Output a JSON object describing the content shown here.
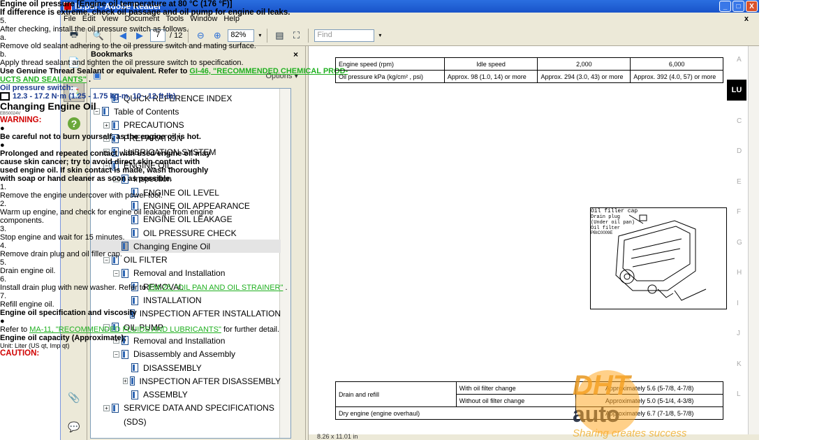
{
  "window": {
    "title": "lu.pdf - Adobe Reader",
    "minimize": "_",
    "maximize": "□",
    "close": "X"
  },
  "menu": [
    "File",
    "Edit",
    "View",
    "Document",
    "Tools",
    "Window",
    "Help"
  ],
  "menu_close": "x",
  "toolbar": {
    "page_current": "7",
    "page_total": "/ 12",
    "zoom": "82%",
    "find_placeholder": "Find"
  },
  "bookmarks": {
    "title": "Bookmarks",
    "close": "×",
    "options": "Options ▾",
    "items": [
      {
        "label": "QUICK REFERENCE INDEX",
        "level": 1,
        "exp": ""
      },
      {
        "label": "Table of Contents",
        "level": 0,
        "exp": "−"
      },
      {
        "label": "PRECAUTIONS",
        "level": 1,
        "exp": "+"
      },
      {
        "label": "PREPARATION",
        "level": 1,
        "exp": "+"
      },
      {
        "label": "LUBRICATION SYSTEM",
        "level": 1,
        "exp": "+"
      },
      {
        "label": "ENGINE OIL",
        "level": 1,
        "exp": "−"
      },
      {
        "label": "Inspection",
        "level": 2,
        "exp": "−"
      },
      {
        "label": "ENGINE OIL LEVEL",
        "level": 3,
        "exp": ""
      },
      {
        "label": "ENGINE OIL APPEARANCE",
        "level": 3,
        "exp": ""
      },
      {
        "label": "ENGINE OIL LEAKAGE",
        "level": 3,
        "exp": ""
      },
      {
        "label": "OIL PRESSURE CHECK",
        "level": 3,
        "exp": ""
      },
      {
        "label": "Changing Engine Oil",
        "level": 2,
        "exp": "",
        "selected": true
      },
      {
        "label": "OIL FILTER",
        "level": 1,
        "exp": "−"
      },
      {
        "label": "Removal and Installation",
        "level": 2,
        "exp": "−"
      },
      {
        "label": "REMOVAL",
        "level": 3,
        "exp": ""
      },
      {
        "label": "INSTALLATION",
        "level": 3,
        "exp": ""
      },
      {
        "label": "INSPECTION AFTER INSTALLATION",
        "level": 3,
        "exp": ""
      },
      {
        "label": "OIL PUMP",
        "level": 1,
        "exp": "−"
      },
      {
        "label": "Removal and Installation",
        "level": 2,
        "exp": "+"
      },
      {
        "label": "Disassembly and Assembly",
        "level": 2,
        "exp": "−"
      },
      {
        "label": "DISASSEMBLY",
        "level": 3,
        "exp": ""
      },
      {
        "label": "INSPECTION AFTER DISASSEMBLY",
        "level": 3,
        "exp": "+"
      },
      {
        "label": "ASSEMBLY",
        "level": 3,
        "exp": ""
      },
      {
        "label": "SERVICE DATA AND SPECIFICATIONS",
        "level": 1,
        "exp": "+"
      },
      {
        "label": "(SDS)",
        "level": 1,
        "exp": "",
        "cont": true
      }
    ]
  },
  "doc": {
    "heading_pressure": "Engine oil pressure [Engine oil temperature at 80 °C (176 °F)]",
    "pressure_table": {
      "r1": [
        "Engine speed (rpm)",
        "Idle speed",
        "2,000",
        "6,000"
      ],
      "r2": [
        "Oil pressure kPa (kg/cm² , psi)",
        "Approx. 98 (1.0, 14) or more",
        "Approx. 294 (3.0, 43) or more",
        "Approx. 392 (4.0, 57) or more"
      ]
    },
    "diff_line": "If difference is extreme, check oil passage and oil pump for engine oil leaks.",
    "s5_num": "5.",
    "s5": "After checking, install the oil pressure switch as follows.",
    "sa_num": "a.",
    "sa": "Remove old sealant adhering to the oil pressure switch and mating surface.",
    "sb_num": "b.",
    "sb": "Apply thread sealant and tighten the oil pressure switch to specification.",
    "sb2": "Use Genuine Thread Sealant or equivalent. Refer to ",
    "sb_link1": "GI-46, \"RECOMMENDED CHEMICAL PROD-",
    "sb_link2": "UCTS AND SEALANTS\"",
    "sb_end": " .",
    "ops_label": "Oil pressure switch:",
    "ops_torque": "12.3 - 17.2 N·m (1.25 - 1.75 kg-m, 10 - 12 ft-lb)",
    "changing_title": "Changing Engine Oil",
    "changing_code": "EBS0024V",
    "warning": "WARNING:",
    "w1": "Be careful not to burn yourself, as the engine oil is hot.",
    "w2a": "Prolonged and repeated contact with used engine oil may",
    "w2b": "cause skin cancer; try to avoid direct skin contact with",
    "w2c": "used engine oil. If skin contact is made, wash thoroughly",
    "w2d": "with soap or hand cleaner as soon as possible.",
    "steps": [
      {
        "n": "1.",
        "t": "Remove the engine undercover with power tool."
      },
      {
        "n": "2.",
        "t": "Warm up engine, and check for engine oil leakage from engine"
      },
      {
        "n": "",
        "t": "components."
      },
      {
        "n": "3.",
        "t": "Stop engine and wait for 15 minutes."
      },
      {
        "n": "4.",
        "t": "Remove drain plug and oil filler cap."
      },
      {
        "n": "5.",
        "t": "Drain engine oil."
      }
    ],
    "s6_num": "6.",
    "s6": "Install drain plug with new washer. Refer to ",
    "s6_link": "EM-25, \"OIL PAN AND OIL STRAINER\"",
    "s6_end": " .",
    "s7_num": "7.",
    "s7": "Refill engine oil.",
    "spec_head": "Engine oil specification and viscosity",
    "spec_refer": "Refer to ",
    "spec_link": "MA-11, \"RECOMMENDED FLUIDS AND LUBRICANTS\"",
    "spec_end": " for further detail.",
    "cap_head": "Engine oil capacity (Approximate);",
    "cap_unit": "Unit: Liter (US qt, Imp qt)",
    "cap_table": {
      "drain": "Drain and refill",
      "with": "With oil filter change",
      "without": "Without oil filter change",
      "dry": "Dry engine (engine overhaul)",
      "v1": "Approximately 5.6 (5-7/8, 4-7/8)",
      "v2": "Approximately 5.0 (5-1/4, 4-3/8)",
      "v3": "Approximately 6.7 (7-1/8, 5-7/8)"
    },
    "caution": "CAUTION:",
    "fig": {
      "filler": "Oil filler cap",
      "drain1": "Drain plug",
      "drain2": "(Under oil pan)",
      "filter": "Oil filter",
      "code": "PBIC0009E"
    }
  },
  "side_index": [
    "A",
    "LU",
    "C",
    "D",
    "E",
    "F",
    "G",
    "H",
    "I",
    "J",
    "K",
    "L"
  ],
  "status": {
    "page_size": "8.26 x 11.01 in"
  },
  "watermark": {
    "brand_dht": "DHT",
    "brand_auto": "auto",
    "slogan": "Sharing creates success"
  }
}
